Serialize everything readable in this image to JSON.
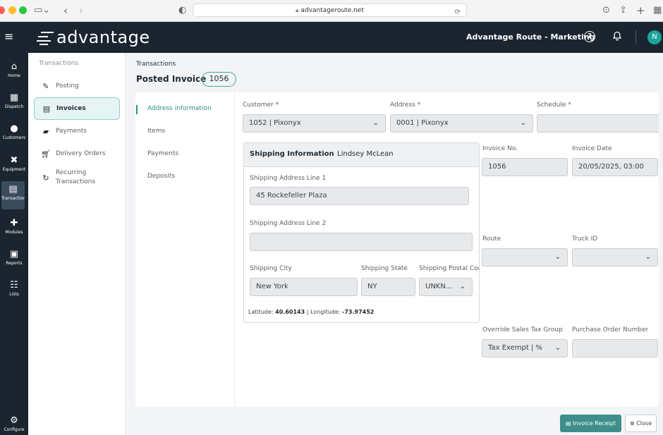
{
  "browser": {
    "url": "advantageroute.net"
  },
  "header": {
    "logo_text": "advantage",
    "org_title": "Advantage Route - Marketing",
    "avatar_initial": "N"
  },
  "rail": {
    "items": [
      {
        "label": "Home",
        "icon": "home-icon"
      },
      {
        "label": "Dispatch",
        "icon": "calendar-icon"
      },
      {
        "label": "Customers",
        "icon": "user-icon"
      },
      {
        "label": "Equipment",
        "icon": "tools-icon"
      },
      {
        "label": "Transactions",
        "icon": "document-icon"
      },
      {
        "label": "Modules",
        "icon": "puzzle-icon"
      },
      {
        "label": "Reports",
        "icon": "report-icon"
      },
      {
        "label": "Lists",
        "icon": "list-icon"
      },
      {
        "label": "Configure",
        "icon": "gear-icon"
      }
    ]
  },
  "subnav": {
    "header": "Transactions",
    "items": [
      {
        "label": "Posting"
      },
      {
        "label": "Invoices"
      },
      {
        "label": "Payments"
      },
      {
        "label": "Delivery Orders"
      },
      {
        "label": "Recurring Transactions"
      }
    ]
  },
  "main": {
    "breadcrumb": "Transactions",
    "title": "Posted Invoice",
    "invoice_number": "1056"
  },
  "sections": [
    "Address information",
    "Items",
    "Payments",
    "Deposits"
  ],
  "form": {
    "customer": {
      "label": "Customer *",
      "value": "1052 | Pixonyx"
    },
    "address": {
      "label": "Address *",
      "value": "0001 | Pixonyx"
    },
    "schedule": {
      "label": "Schedule *",
      "value": ""
    },
    "invoice_no": {
      "label": "Invoice No.",
      "value": "1056"
    },
    "invoice_date": {
      "label": "Invoice Date",
      "value": "20/05/2025, 03:00"
    },
    "route": {
      "label": "Route",
      "value": ""
    },
    "truck_id": {
      "label": "Truck ID",
      "value": ""
    },
    "override_tax": {
      "label": "Override Sales Tax Group",
      "value": "Tax Exempt | %"
    },
    "po_number": {
      "label": "Purchase Order Number",
      "value": ""
    }
  },
  "shipping": {
    "title": "Shipping Information",
    "contact": "Lindsey McLean",
    "line1": {
      "label": "Shipping Address Line 1",
      "value": "45 Rockefeller Plaza"
    },
    "line2": {
      "label": "Shipping Address Line 2",
      "value": ""
    },
    "city": {
      "label": "Shipping City",
      "value": "New York"
    },
    "state": {
      "label": "Shipping State",
      "value": "NY"
    },
    "postal": {
      "label": "Shipping Postal Code",
      "value": "UNKN..."
    },
    "latitude_label": "Latitude:",
    "latitude": "40.60143",
    "longitude_label": "Longitude:",
    "longitude": "-73.97452"
  },
  "footer": {
    "receipt_label": "Invoice Receipt",
    "close_label": "Close"
  }
}
